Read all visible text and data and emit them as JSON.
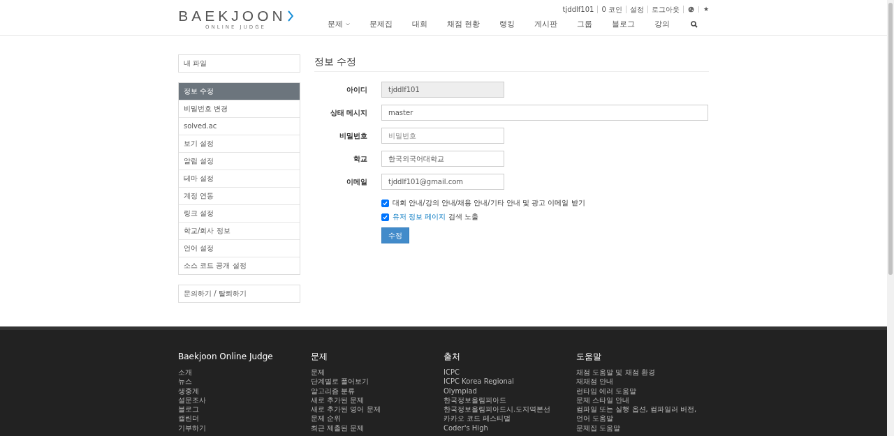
{
  "header": {
    "logo": {
      "wordmark": "BAEKJOON",
      "subtitle": "ONLINE JUDGE"
    },
    "user_links": [
      "tjddlf101",
      "0 코인",
      "설정",
      "로그아웃"
    ],
    "star": "★",
    "nav": [
      {
        "label": "문제",
        "dropdown": true
      },
      {
        "label": "문제집",
        "dropdown": false
      },
      {
        "label": "대회",
        "dropdown": false
      },
      {
        "label": "채점 현황",
        "dropdown": false
      },
      {
        "label": "랭킹",
        "dropdown": false
      },
      {
        "label": "게시판",
        "dropdown": false
      },
      {
        "label": "그룹",
        "dropdown": false
      },
      {
        "label": "블로그",
        "dropdown": false
      },
      {
        "label": "강의",
        "dropdown": false
      }
    ]
  },
  "sidebar": {
    "groups": [
      [
        {
          "label": "내 파일",
          "selected": false
        }
      ],
      [
        {
          "label": "정보 수정",
          "selected": true
        },
        {
          "label": "비밀번호 변경",
          "selected": false
        },
        {
          "label": "solved.ac",
          "selected": false
        },
        {
          "label": "보기 설정",
          "selected": false
        },
        {
          "label": "알림 설정",
          "selected": false
        },
        {
          "label": "테마 설정",
          "selected": false
        },
        {
          "label": "계정 연동",
          "selected": false
        },
        {
          "label": "링크 설정",
          "selected": false
        },
        {
          "label": "학교/회사 정보",
          "selected": false
        },
        {
          "label": "언어 설정",
          "selected": false
        },
        {
          "label": "소스 코드 공개 설정",
          "selected": false
        }
      ],
      [
        {
          "label": "문의하기 / 탈퇴하기",
          "selected": false
        }
      ]
    ]
  },
  "form": {
    "title": "정보 수정",
    "fields": [
      {
        "label": "아이디",
        "value": "tjddlf101",
        "disabled": true,
        "wide": false
      },
      {
        "label": "상태 메시지",
        "value": "master",
        "disabled": false,
        "wide": true
      },
      {
        "label": "비밀번호",
        "placeholder": "비밀번호",
        "disabled": false,
        "wide": false
      },
      {
        "label": "학교",
        "value": "한국외국어대학교",
        "disabled": false,
        "wide": false
      },
      {
        "label": "이메일",
        "value": "tjddlf101@gmail.com",
        "disabled": false,
        "wide": false
      }
    ],
    "checkboxes": [
      {
        "label": "대회 안내/강의 안내/채용 안내/기타 안내 및 광고 이메일 받기",
        "checked": true
      },
      {
        "link": "유저 정보 페이지",
        "label": " 검색 노출",
        "checked": true
      }
    ],
    "submit": "수정"
  },
  "footer": {
    "columns": [
      {
        "title": "Baekjoon Online Judge",
        "links": [
          "소개",
          "뉴스",
          "생중계",
          "설문조사",
          "블로그",
          "캘린더",
          "기부하기"
        ]
      },
      {
        "title": "문제",
        "links": [
          "문제",
          "단계별로 풀어보기",
          "알고리즘 분류",
          "새로 추가된 문제",
          "새로 추가된 영어 문제",
          "문제 순위",
          "최근 제출된 문제"
        ]
      },
      {
        "title": "출처",
        "links": [
          "ICPC",
          "ICPC Korea Regional",
          "Olympiad",
          "한국정보올림피아드",
          "한국정보올림피아드시.도지역본선",
          "카카오 코드 페스티벌",
          "Coder's High"
        ]
      },
      {
        "title": "도움말",
        "links": [
          "채점 도움말 및 채점 환경",
          "재채점 안내",
          "런타임 에러 도움말",
          "문제 스타일 안내",
          "컴파일 또는 실행 옵션, 컴파일러 버전, 언어 도움말",
          "문제집 도움말"
        ]
      }
    ]
  }
}
